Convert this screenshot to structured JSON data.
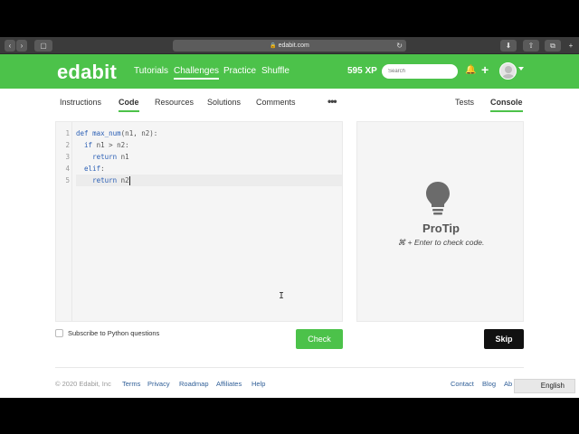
{
  "browser": {
    "url": "edabit.com",
    "back_glyph": "‹",
    "forward_glyph": "›",
    "sidebar_glyph": "▢",
    "reload_glyph": "↻",
    "download_glyph": "⬇",
    "share_glyph": "⇧",
    "tabs_glyph": "⧉",
    "addtab_glyph": "+"
  },
  "nav": {
    "logo": "edabit",
    "links": [
      "Tutorials",
      "Challenges",
      "Practice",
      "Shuffle"
    ],
    "active": "Challenges",
    "xp": "595 XP",
    "search_placeholder": "Search",
    "bell_glyph": "🔔",
    "plus_glyph": "+"
  },
  "tabs": {
    "left": [
      "Instructions",
      "Code",
      "Resources",
      "Solutions",
      "Comments"
    ],
    "more": "•••",
    "right": [
      "Tests",
      "Console"
    ]
  },
  "editor": {
    "line_numbers": [
      "1",
      "2",
      "3",
      "4",
      "5"
    ],
    "lines": [
      {
        "kw": "def ",
        "fn": "max_num",
        "rest": "(n1, n2):"
      },
      {
        "indent": "  ",
        "kw": "if ",
        "rest": "n1 > n2:"
      },
      {
        "indent": "    ",
        "kw": "return ",
        "rest": "n1"
      },
      {
        "indent": "  ",
        "kw": "elif",
        "rest": ":"
      },
      {
        "indent": "    ",
        "kw": "return ",
        "rest": "n2"
      }
    ],
    "cursor_glyph": "I"
  },
  "console": {
    "title": "ProTip",
    "tip": "⌘ + Enter to check code."
  },
  "controls": {
    "subscribe_label": "Subscribe to Python questions",
    "check": "Check",
    "skip": "Skip"
  },
  "footer": {
    "copyright": "© 2020 Edabit, Inc",
    "links_left": [
      "Terms",
      "Privacy",
      "Roadmap",
      "Affiliates",
      "Help"
    ],
    "links_right": [
      "Contact",
      "Blog",
      "Ab"
    ],
    "language": "English"
  },
  "colors": {
    "brand_green": "#4cc24a",
    "keyword_blue": "#2b5fb5"
  }
}
